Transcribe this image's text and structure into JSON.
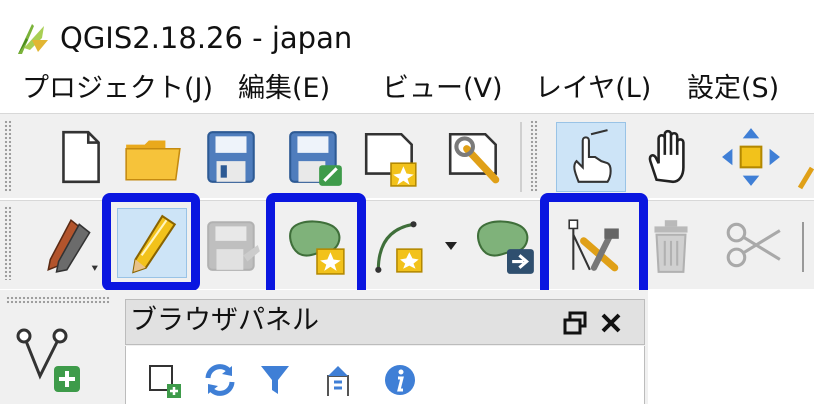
{
  "window": {
    "title": "QGIS2.18.26 - japan",
    "logo_icon": "qgis-logo-icon"
  },
  "menu": [
    {
      "label": "プロジェクト(J)"
    },
    {
      "label": "編集(E)"
    },
    {
      "label": "ビュー(V)"
    },
    {
      "label": "レイヤ(L)"
    },
    {
      "label": "設定(S)"
    }
  ],
  "toolbar_file": {
    "buttons": [
      {
        "icon": "new-project-icon"
      },
      {
        "icon": "open-folder-icon"
      },
      {
        "icon": "save-icon"
      },
      {
        "icon": "save-as-icon"
      },
      {
        "icon": "new-print-composer-icon"
      },
      {
        "icon": "composer-manager-icon"
      }
    ]
  },
  "toolbar_nav": {
    "buttons": [
      {
        "icon": "touch-zoom-pan-icon",
        "active": true
      },
      {
        "icon": "pan-hand-icon"
      },
      {
        "icon": "pan-to-selection-icon"
      }
    ]
  },
  "toolbar_edit": {
    "buttons": [
      {
        "icon": "current-edits-icon",
        "enabled": true
      },
      {
        "icon": "toggle-editing-icon",
        "enabled": true,
        "highlighted": true
      },
      {
        "icon": "save-layer-edits-icon",
        "enabled": false
      },
      {
        "icon": "add-feature-icon",
        "enabled": true,
        "highlighted": true
      },
      {
        "icon": "add-circular-string-icon",
        "enabled": true
      },
      {
        "icon": "move-feature-icon",
        "enabled": true
      },
      {
        "icon": "node-tool-icon",
        "enabled": true,
        "highlighted": true
      },
      {
        "icon": "delete-selected-icon",
        "enabled": false
      },
      {
        "icon": "cut-features-icon",
        "enabled": false
      }
    ]
  },
  "highlight_color": "#0a16e0",
  "browser_panel": {
    "title": "ブラウザパネル",
    "tools": [
      {
        "icon": "add-selected-layers-icon"
      },
      {
        "icon": "refresh-icon"
      },
      {
        "icon": "filter-icon"
      },
      {
        "icon": "collapse-all-icon"
      },
      {
        "icon": "info-icon"
      }
    ]
  },
  "side_panel": {
    "icon": "new-vector-layer-icon"
  }
}
